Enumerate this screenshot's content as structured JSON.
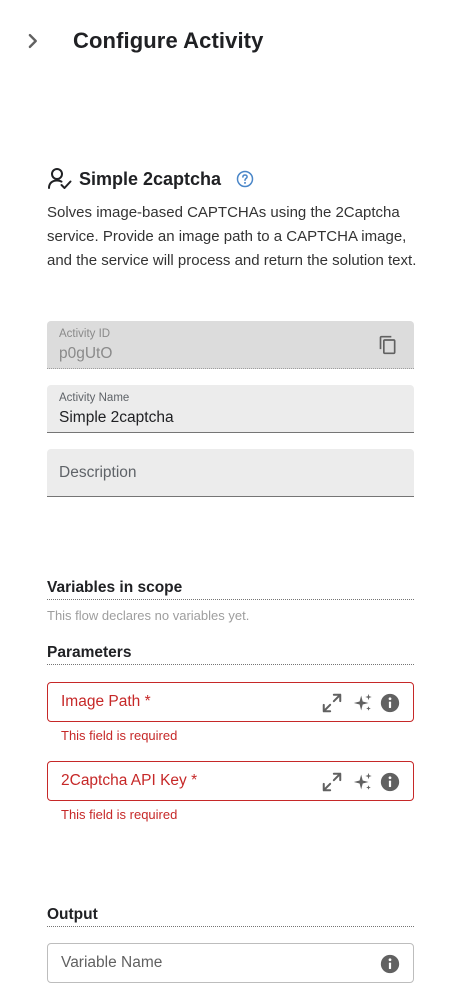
{
  "header": {
    "title": "Configure Activity"
  },
  "activity": {
    "name": "Simple 2captcha",
    "description": "Solves image-based CAPTCHAs using the 2Captcha service. Provide an image path to a CAPTCHA image, and the service will process and return the solution text."
  },
  "fields": {
    "activity_id": {
      "label": "Activity ID",
      "value": "p0gUtO"
    },
    "activity_name": {
      "label": "Activity Name",
      "value": "Simple 2captcha"
    },
    "description": {
      "label": "Description"
    }
  },
  "variables": {
    "heading": "Variables in scope",
    "empty_text": "This flow declares no variables yet."
  },
  "parameters": {
    "heading": "Parameters",
    "items": [
      {
        "label": "Image Path *",
        "error": "This field is required"
      },
      {
        "label": "2Captcha API Key *",
        "error": "This field is required"
      }
    ]
  },
  "output": {
    "heading": "Output",
    "variable_name_label": "Variable Name"
  },
  "colors": {
    "accent": "#4a86c8",
    "error": "#c62828",
    "icon": "#616161"
  }
}
